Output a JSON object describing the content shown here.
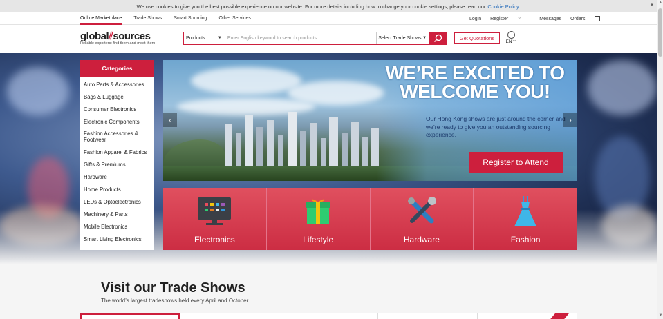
{
  "cookie": {
    "text": "We use cookies to give you the best possible experience on our website. For more details including how to change your cookie settings, please read our",
    "link": "Cookie Policy.",
    "close": "×"
  },
  "topnav": {
    "left": [
      "Online Marketplace",
      "Trade Shows",
      "Smart Sourcing",
      "Other Services"
    ],
    "login": "Login",
    "register": "Register",
    "messages": "Messages",
    "orders": "Orders"
  },
  "logo": {
    "part1": "global",
    "part2": "sources",
    "tagline": "Reliable exporters: find them and meet them"
  },
  "search": {
    "category": "Products",
    "placeholder": "Enter English keyword to search products",
    "shows": "Select Trade Shows"
  },
  "header": {
    "quote_button": "Get Quotations",
    "lang": "EN"
  },
  "categories": {
    "title": "Categories",
    "items": [
      "Auto Parts & Accessories",
      "Bags & Luggage",
      "Consumer Electronics",
      "Electronic Components",
      "Fashion Accessories & Footwear",
      "Fashion Apparel & Fabrics",
      "Gifts & Premiums",
      "Hardware",
      "Home Products",
      "LEDs & Optoelectronics",
      "Machinery & Parts",
      "Mobile Electronics",
      "Smart Living Electronics"
    ]
  },
  "banner": {
    "headline_1": "WE’RE EXCITED TO",
    "headline_2": "WELCOME YOU!",
    "copy": "Our Hong Kong shows are just around the corner and we’re ready to give you an outstanding sourcing experience.",
    "cta": "Register to Attend"
  },
  "tiles": [
    "Electronics",
    "Lifestyle",
    "Hardware",
    "Fashion"
  ],
  "trade_shows": {
    "title": "Visit our Trade Shows",
    "subtitle": "The world’s largest tradeshows held every April and October"
  },
  "colors": {
    "brand_red": "#cd1f3d",
    "link_blue": "#2a6ebb"
  }
}
